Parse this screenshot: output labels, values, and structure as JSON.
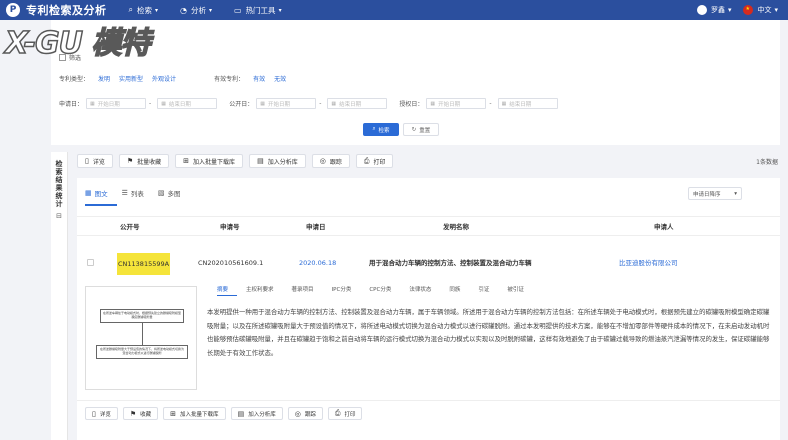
{
  "brand": {
    "logo": "P",
    "title": "专利检索及分析"
  },
  "nav": [
    {
      "icon": "search-icon",
      "glyph": "⌕",
      "label": "检索"
    },
    {
      "icon": "analysis-icon",
      "glyph": "◔",
      "label": "分析"
    },
    {
      "icon": "monitor-icon",
      "glyph": "▭",
      "label": "热门工具"
    }
  ],
  "user": {
    "name": "罗鑫"
  },
  "lang": {
    "label": "中文"
  },
  "watermark": "X-GU 模特",
  "filter": {
    "head_label": "筛选",
    "patent_type_label": "专利类型：",
    "patent_types": [
      "发明",
      "实用新型",
      "外观设计"
    ],
    "valid_label": "有效专利：",
    "valid_options": [
      "有效",
      "无效"
    ],
    "date_fields": [
      {
        "label": "申请日：",
        "start": "开始日期",
        "end": "结束日期"
      },
      {
        "label": "公开日：",
        "start": "开始日期",
        "end": "结束日期"
      },
      {
        "label": "授权日：",
        "start": "开始日期",
        "end": "结束日期"
      }
    ],
    "search_btn": "检索",
    "reset_btn": "重置"
  },
  "side_tab": {
    "label": "检索结果统计"
  },
  "toolbar": {
    "buttons": [
      {
        "icon": "document-icon",
        "glyph": "▯",
        "label": "详览"
      },
      {
        "icon": "bookmark-icon",
        "glyph": "⚑",
        "label": "批量收藏"
      },
      {
        "icon": "download-icon",
        "glyph": "⊞",
        "label": "加入批量下载库"
      },
      {
        "icon": "analysis-lib-icon",
        "glyph": "▤",
        "label": "加入分析库"
      },
      {
        "icon": "track-icon",
        "glyph": "◎",
        "label": "跟踪"
      },
      {
        "icon": "print-icon",
        "glyph": "⎙",
        "label": "打印"
      }
    ],
    "count": "1条数据"
  },
  "views": [
    {
      "icon": "image-text-view-icon",
      "glyph": "▦",
      "label": "图文"
    },
    {
      "icon": "list-view-icon",
      "glyph": "☰",
      "label": "列表"
    },
    {
      "icon": "multi-image-view-icon",
      "glyph": "▧",
      "label": "多图"
    }
  ],
  "sort": {
    "label": "申请日降序"
  },
  "table": {
    "headers": [
      "公开号",
      "申请号",
      "申请日",
      "发明名称",
      "申请人"
    ],
    "row": {
      "pub_no": "CN113815599A",
      "app_no": "CN202010561609.1",
      "app_date": "2020.06.18",
      "title": "用于混合动力车辆的控制方法、控制装置及混合动力车辆",
      "applicant": "比亚迪股份有限公司"
    }
  },
  "detail_tabs": [
    "摘要",
    "主权利要求",
    "著录项目",
    "IPC分类",
    "CPC分类",
    "法律状态",
    "同族",
    "引证",
    "被引证"
  ],
  "figure": {
    "box1": "在所述车辆处于电动模式时，根据预先建立的碳罐吸附模型确定碳罐吸附量",
    "box2": "在所述碳罐吸附量大于预设值的情况下，将所述电动模式切换为混合动力模式以进行碳罐脱附"
  },
  "abstract": "本发明提供一种用于混合动力车辆的控制方法、控制装置及混合动力车辆，属于车辆领域。所述用于混合动力车辆的控制方法包括：在所述车辆处于电动模式时，根据预先建立的碳罐吸附模型确定碳罐吸附量；以及在所述碳罐吸附量大于预设值的情况下，将所述电动模式切换为混合动力模式以进行碳罐脱附。通过本发明提供的技术方案，能够在不增加零部件等硬件成本的情况下，在未启动发动机时也能够预估碳罐吸附量，并且在碳罐趋于饱和之前自动将车辆的运行模式切换为混合动力模式以实现以及时脱附碳罐，这样有效地避免了由于碳罐过载导致的燃油蒸汽泄漏等情况的发生，保证碳罐能够长期处于有效工作状态。",
  "actions": [
    {
      "icon": "document-icon",
      "glyph": "▯",
      "label": "详览"
    },
    {
      "icon": "bookmark-icon",
      "glyph": "⚑",
      "label": "收藏"
    },
    {
      "icon": "download-icon",
      "glyph": "⊞",
      "label": "加入批量下载库"
    },
    {
      "icon": "analysis-lib-icon",
      "glyph": "▤",
      "label": "加入分析库"
    },
    {
      "icon": "track-icon",
      "glyph": "◎",
      "label": "跟踪"
    },
    {
      "icon": "print-icon",
      "glyph": "⎙",
      "label": "打印"
    }
  ]
}
